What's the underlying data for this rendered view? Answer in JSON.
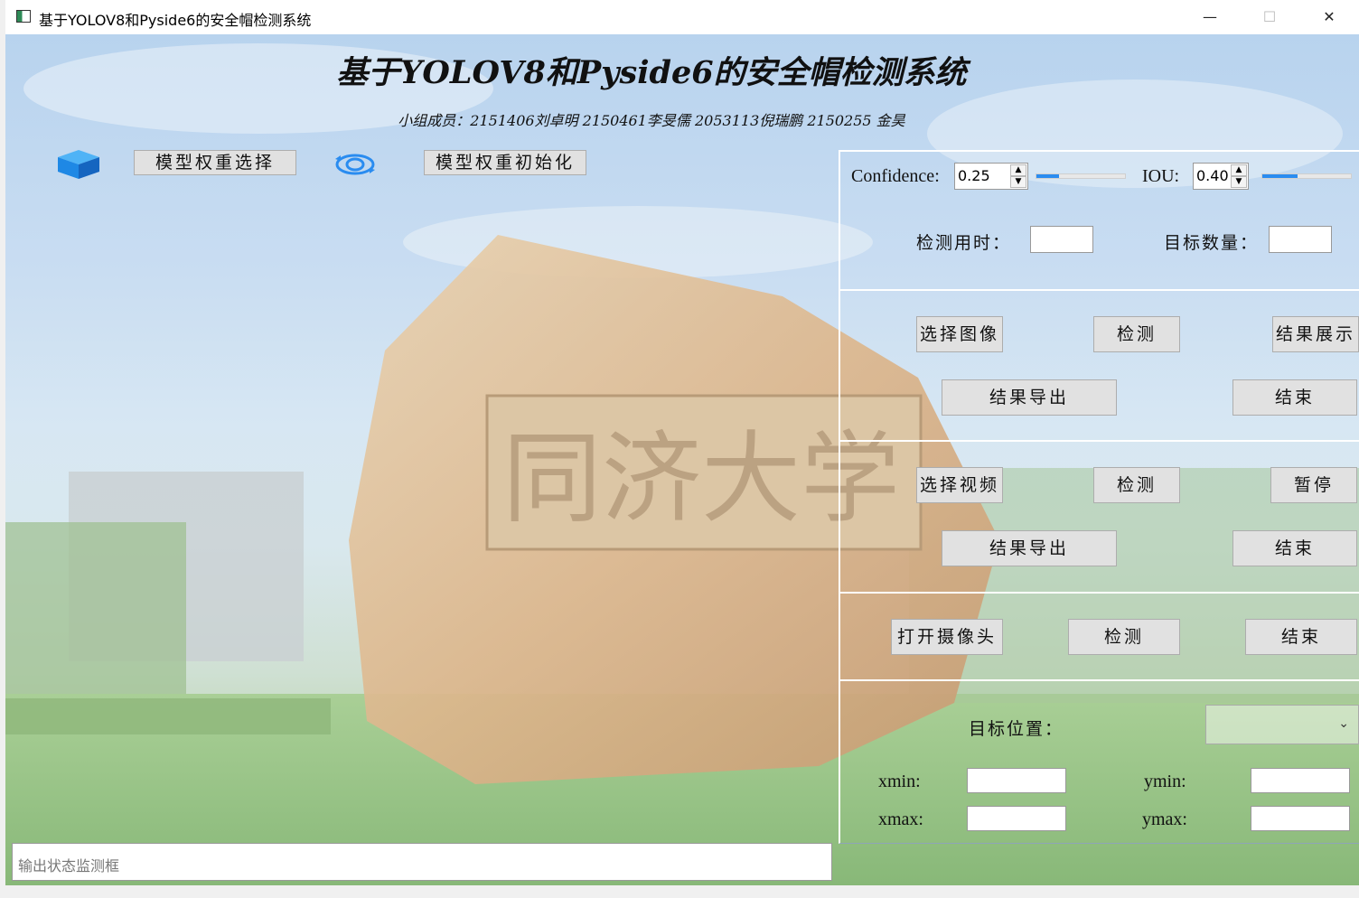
{
  "window": {
    "title": "基于YOLOV8和Pyside6的安全帽检测系统",
    "minimize": "—",
    "maximize": "☐",
    "close": "✕"
  },
  "header": {
    "title": "基于YOLOV8和Pyside6的安全帽检测系统",
    "members": "小组成员：2151406刘卓明 2150461李旻儒 2053113倪瑞鹏 2150255 金昊"
  },
  "toolbar": {
    "model_select": "模型权重选择",
    "model_init": "模型权重初始化"
  },
  "params": {
    "confidence_label": "Confidence:",
    "confidence_value": "0.25",
    "confidence_level": 0.25,
    "iou_label": "IOU:",
    "iou_value": "0.40",
    "iou_level": 0.4,
    "time_label": "检测用时：",
    "time_value": "",
    "count_label": "目标数量：",
    "count_value": ""
  },
  "image_section": {
    "select": "选择图像",
    "detect": "检测",
    "show": "结果展示",
    "export": "结果导出",
    "end": "结束"
  },
  "video_section": {
    "select": "选择视频",
    "detect": "检测",
    "pause": "暂停",
    "export": "结果导出",
    "end": "结束"
  },
  "camera_section": {
    "open": "打开摄像头",
    "detect": "检测",
    "end": "结束"
  },
  "position_section": {
    "label": "目标位置：",
    "selected": "",
    "xmin_label": "xmin:",
    "ymin_label": "ymin:",
    "xmax_label": "xmax:",
    "ymax_label": "ymax:",
    "xmin": "",
    "ymin": "",
    "xmax": "",
    "ymax": ""
  },
  "status": {
    "placeholder": "输出状态监测框"
  },
  "background_text": "同济大学",
  "colors": {
    "slider_fill": "#2a8cf0",
    "icon_blue": "#1e88e5",
    "button_face": "#e1e1e1"
  }
}
